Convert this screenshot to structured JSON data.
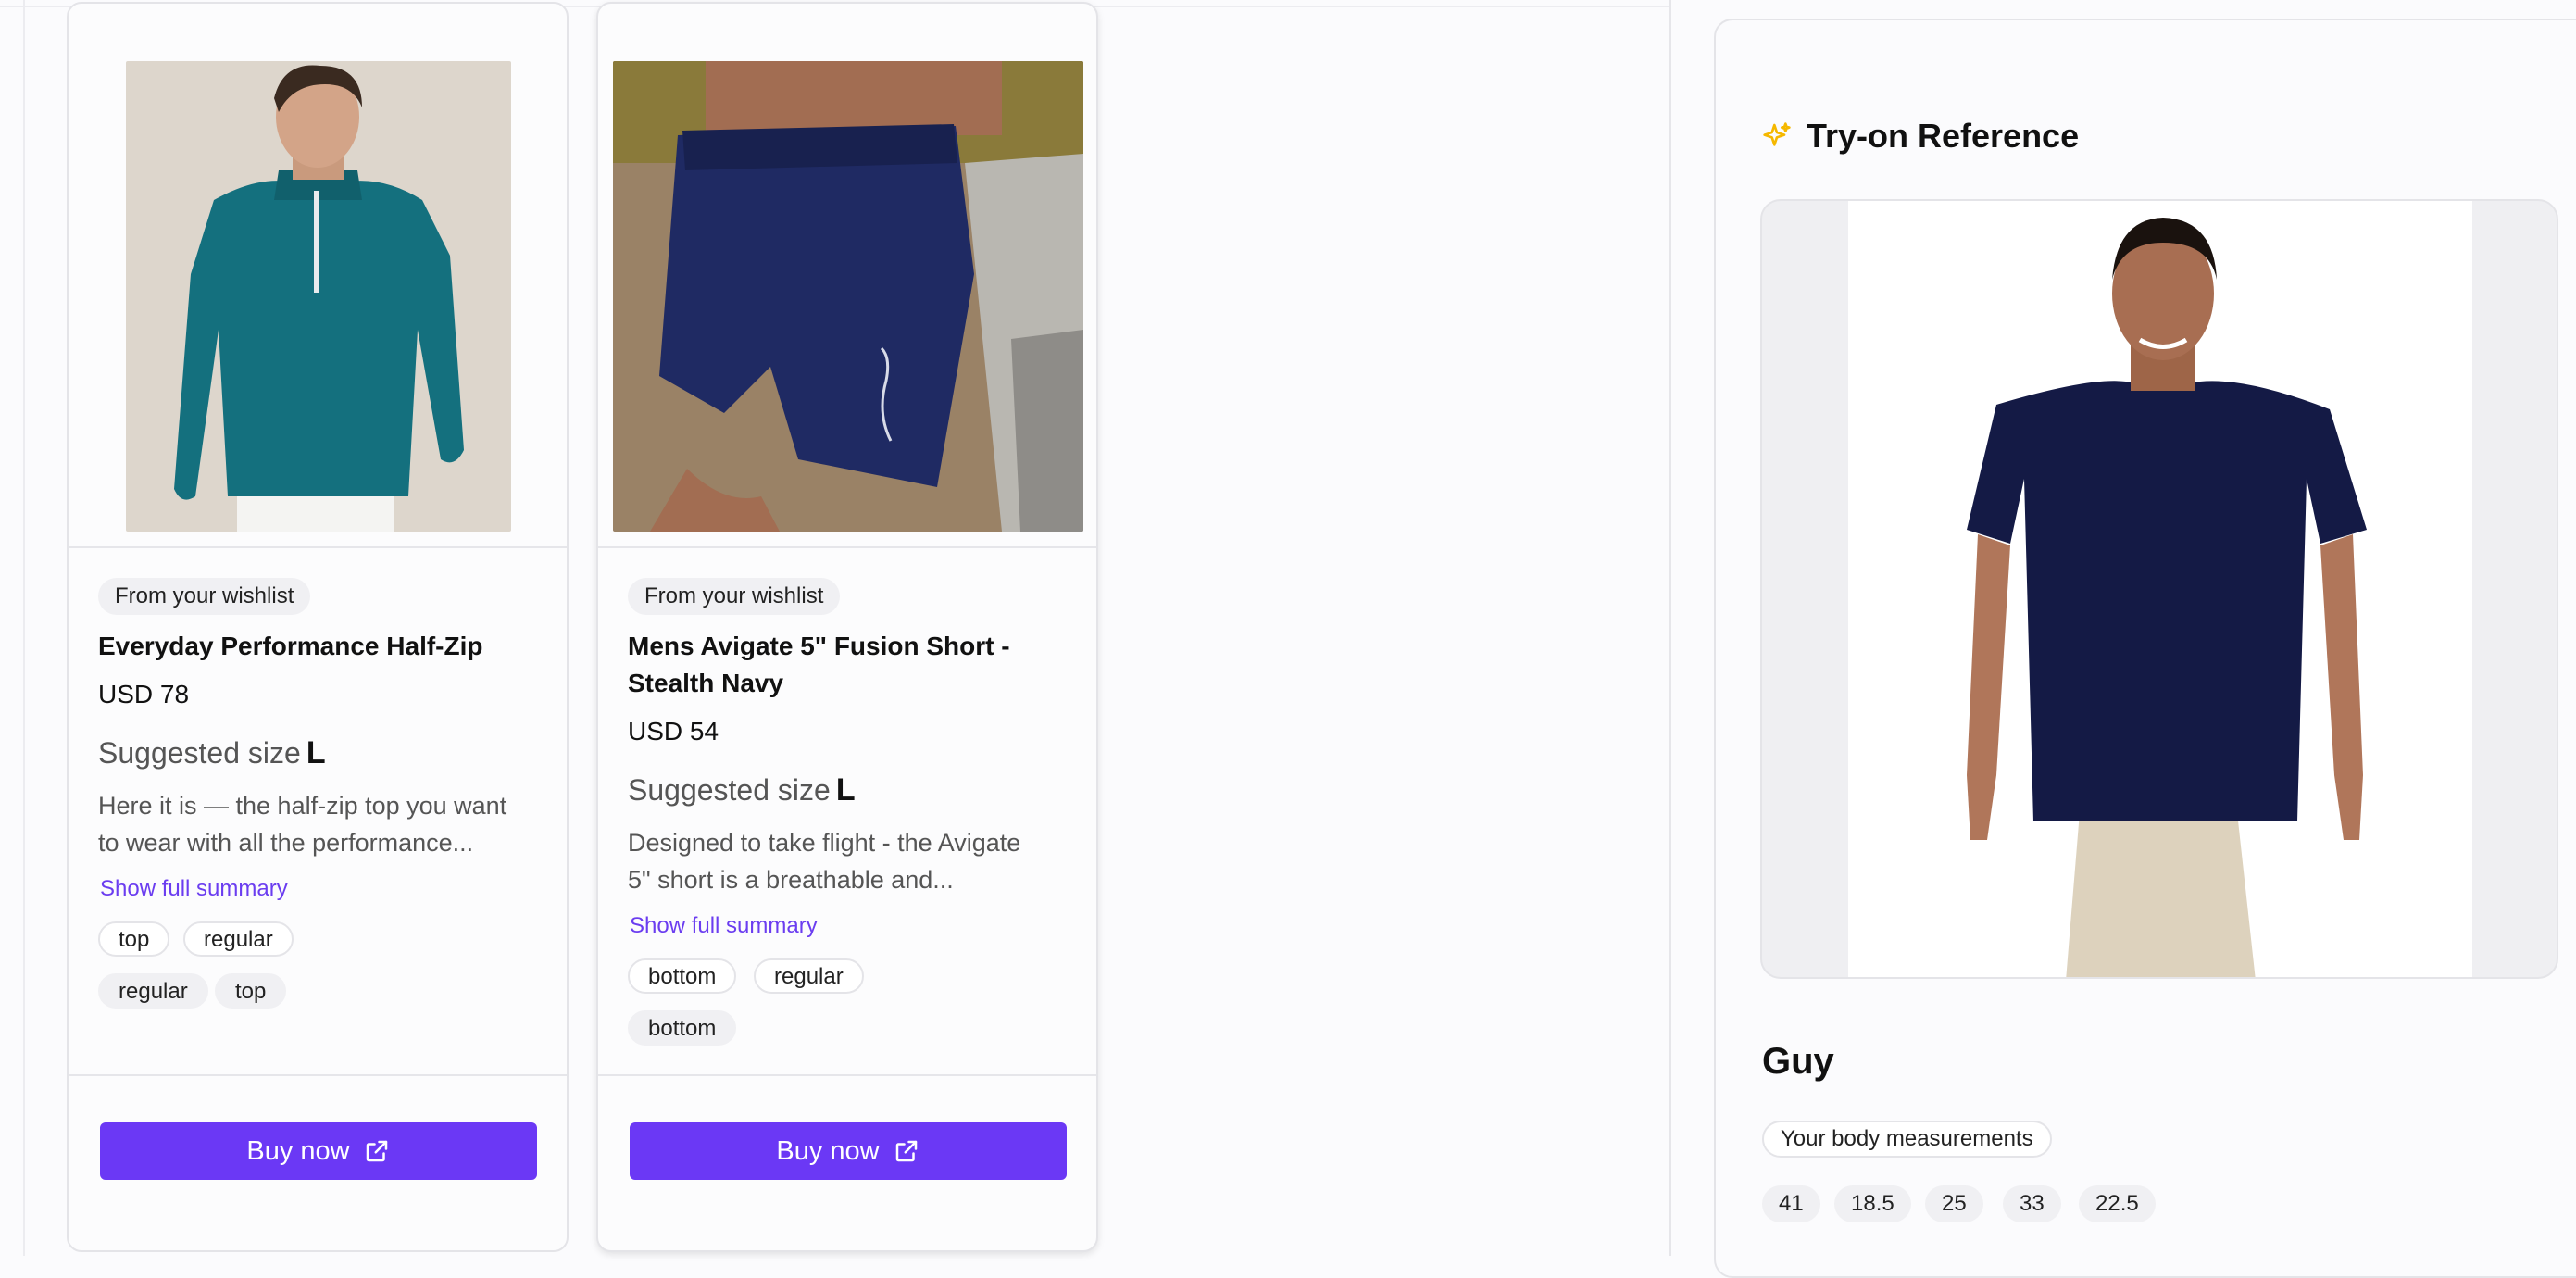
{
  "products": [
    {
      "badge": "From your wishlist",
      "name_lines": [
        "Everyday Performance Half-Zip"
      ],
      "price": "USD 78",
      "suggested_label": "Suggested size",
      "suggested_size": "L",
      "description_lines": [
        "Here it is — the half-zip top you want",
        "to wear with all the performance..."
      ],
      "show_more": "Show full summary",
      "tags_row1": [
        "top",
        "regular"
      ],
      "tags_row2": [
        "regular",
        "top"
      ],
      "buy_label": "Buy now"
    },
    {
      "badge": "From your wishlist",
      "name_lines": [
        "Mens Avigate 5\" Fusion Short -",
        "Stealth Navy"
      ],
      "price": "USD 54",
      "suggested_label": "Suggested size",
      "suggested_size": "L",
      "description_lines": [
        "Designed to take flight - the Avigate",
        "5\" short is a breathable and..."
      ],
      "show_more": "Show full summary",
      "tags_row1": [
        "bottom",
        "regular"
      ],
      "tags_row2": [
        "bottom"
      ],
      "buy_label": "Buy now"
    }
  ],
  "tryon": {
    "title": "Try-on Reference",
    "persona_name": "Guy",
    "measurements_label": "Your body measurements",
    "measurements": [
      "41",
      "18.5",
      "25",
      "33",
      "22.5"
    ]
  },
  "colors": {
    "accent": "#6b38f5",
    "link": "#6b3df0",
    "sparkle": "#f5b800",
    "shirt_teal": "#14707e",
    "shorts_navy": "#1f2a63",
    "tee_navy": "#141a45"
  }
}
